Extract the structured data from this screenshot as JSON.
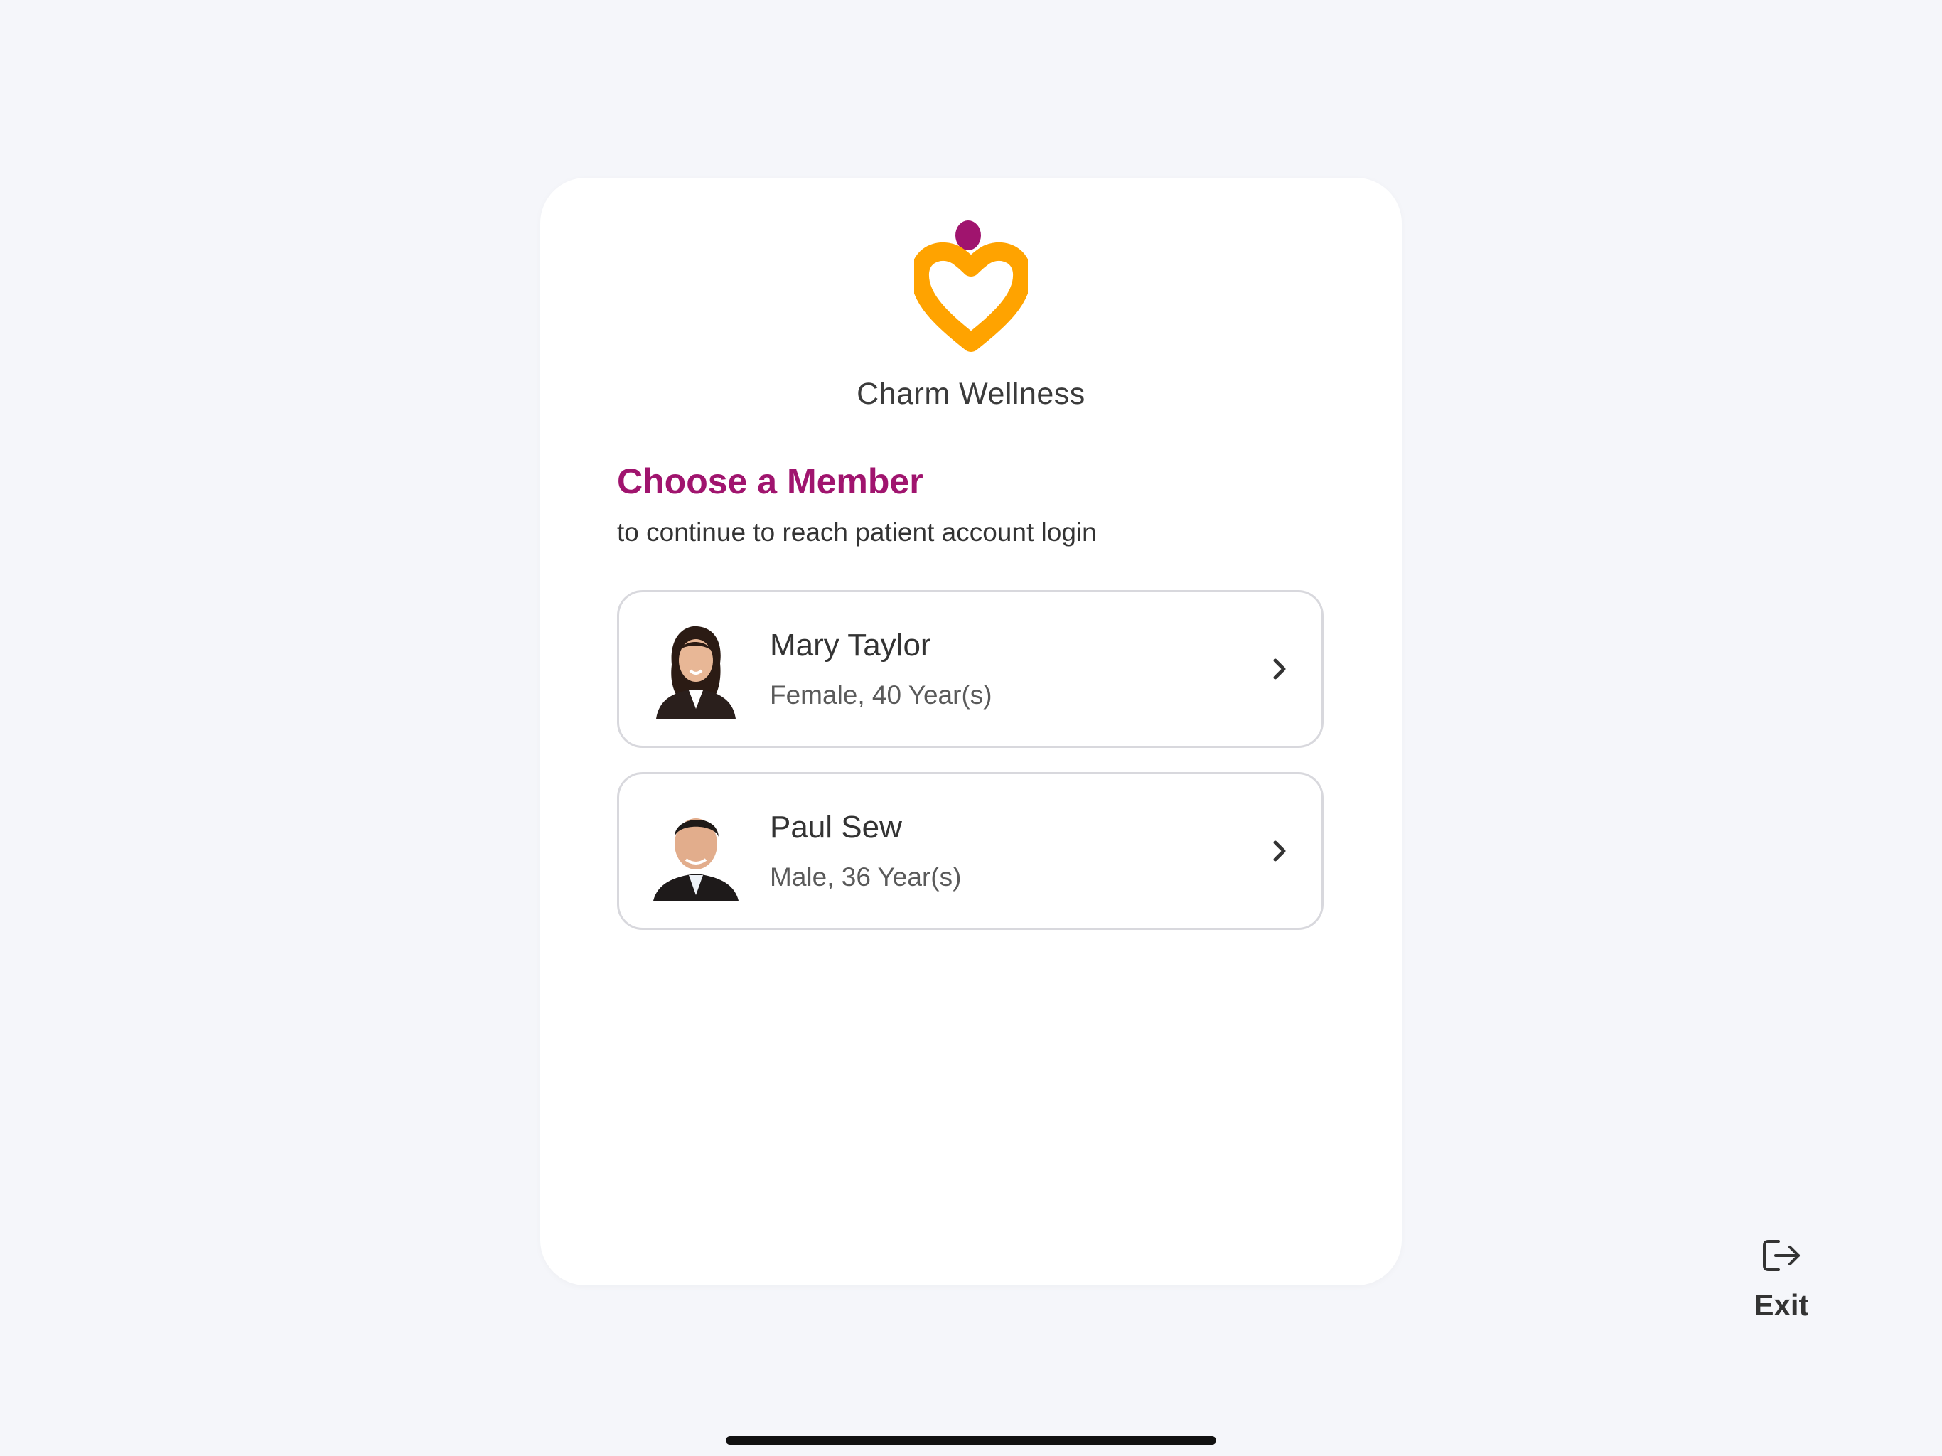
{
  "brand": {
    "name": "Charm Wellness",
    "logo_icon": "heart-person-logo",
    "colors": {
      "heart": "#ffa300",
      "head": "#a0146e"
    }
  },
  "heading": "Choose a Member",
  "subheading": "to continue to reach patient account login",
  "members": [
    {
      "name": "Mary Taylor",
      "details": "Female, 40 Year(s)",
      "avatar_icon": "female-avatar"
    },
    {
      "name": "Paul Sew",
      "details": "Male, 36 Year(s)",
      "avatar_icon": "male-avatar"
    }
  ],
  "exit": {
    "label": "Exit",
    "icon": "exit-icon"
  },
  "colors": {
    "accent": "#a0146e",
    "background": "#f5f6fa",
    "card": "#ffffff"
  }
}
